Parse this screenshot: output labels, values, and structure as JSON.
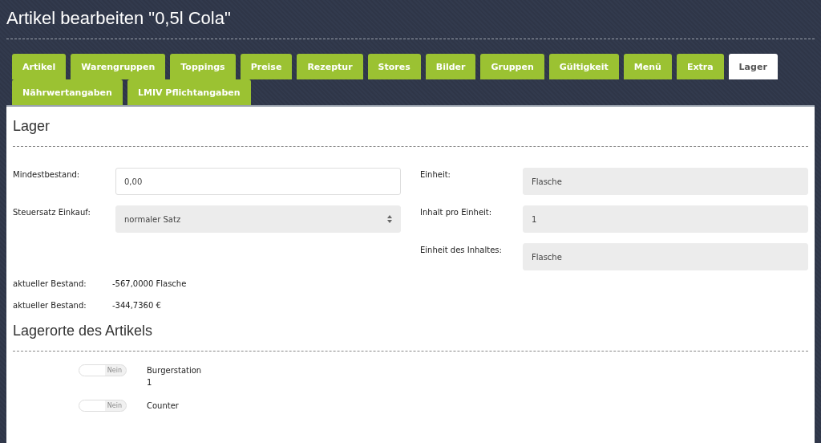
{
  "page_title": "Artikel bearbeiten \"0,5l Cola\"",
  "tabs": [
    {
      "label": "Artikel",
      "selected": false
    },
    {
      "label": "Warengruppen",
      "selected": false
    },
    {
      "label": "Toppings",
      "selected": false
    },
    {
      "label": "Preise",
      "selected": false
    },
    {
      "label": "Rezeptur",
      "selected": false
    },
    {
      "label": "Stores",
      "selected": false
    },
    {
      "label": "Bilder",
      "selected": false
    },
    {
      "label": "Gruppen",
      "selected": false
    },
    {
      "label": "Gültigkeit",
      "selected": false
    },
    {
      "label": "Menü",
      "selected": false
    },
    {
      "label": "Extra",
      "selected": false
    },
    {
      "label": "Lager",
      "selected": true
    },
    {
      "label": "Nährwertangaben",
      "selected": false
    },
    {
      "label": "LMIV Pflichtangaben",
      "selected": false
    }
  ],
  "section_title": "Lager",
  "left_fields": [
    {
      "label": "Mindestbestand:",
      "kind": "input",
      "value": "0,00"
    },
    {
      "label": "Steuersatz Einkauf:",
      "kind": "select",
      "value": "normaler Satz"
    }
  ],
  "right_fields": [
    {
      "label": "Einheit:",
      "kind": "readonly",
      "value": "Flasche"
    },
    {
      "label": "Inhalt pro Einheit:",
      "kind": "readonly",
      "value": "1"
    },
    {
      "label": "Einheit des Inhaltes:",
      "kind": "readonly",
      "value": "Flasche"
    }
  ],
  "stock": [
    {
      "label": "aktueller Bestand:",
      "value": "-567,0000 Flasche"
    },
    {
      "label": "aktueller Bestand:",
      "value": "-344,7360 €"
    }
  ],
  "locations_title": "Lagerorte des Artikels",
  "locations": [
    {
      "name": "Burgerstation",
      "sub": "1",
      "on": false,
      "toggle_label": "Nein"
    },
    {
      "name": "Counter",
      "on": false,
      "toggle_label": "Nein"
    }
  ]
}
